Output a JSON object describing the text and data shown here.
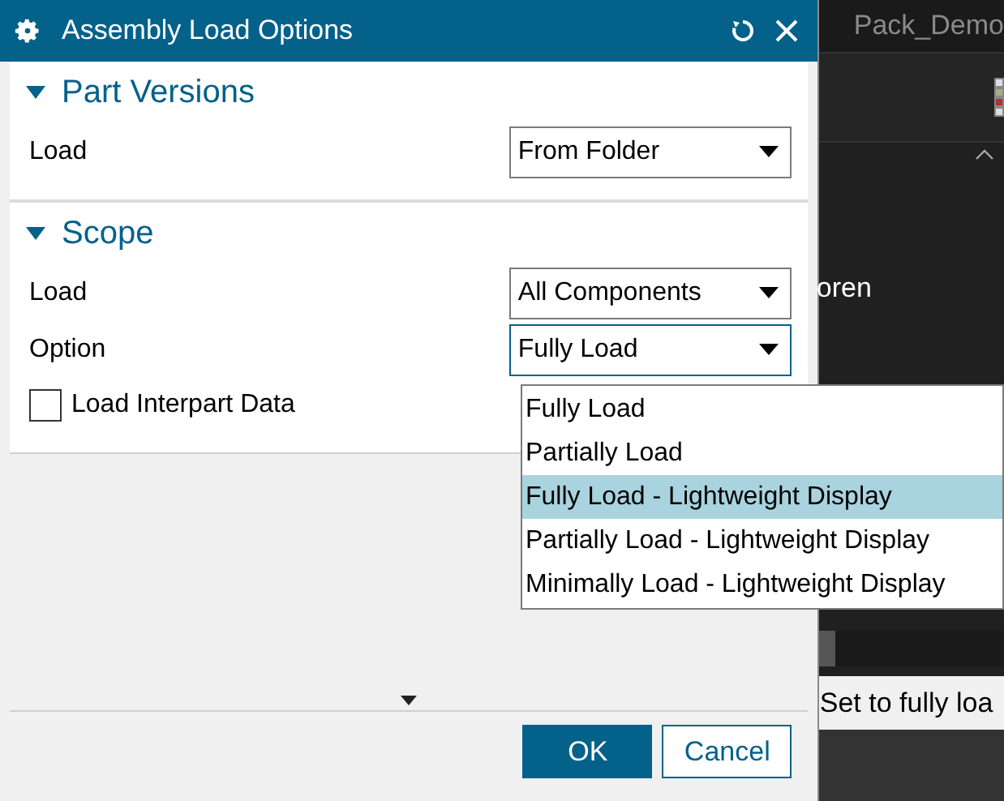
{
  "window": {
    "title": "Assembly Load Options"
  },
  "sections": [
    {
      "title": "Part Versions",
      "expanded": true,
      "rows": [
        {
          "kind": "dropdown",
          "label": "Load",
          "value": "From Folder",
          "open": false
        }
      ]
    },
    {
      "title": "Scope",
      "expanded": true,
      "rows": [
        {
          "kind": "dropdown",
          "label": "Load",
          "value": "All Components",
          "open": false
        },
        {
          "kind": "dropdown",
          "label": "Option",
          "value": "Fully Load",
          "open": true
        },
        {
          "kind": "checkbox",
          "label": "Load Interpart Data",
          "checked": false
        }
      ]
    }
  ],
  "dropdown_list": [
    {
      "label": "Fully Load",
      "selected": false
    },
    {
      "label": "Partially Load",
      "selected": false
    },
    {
      "label": "Fully Load - Lightweight Display",
      "selected": true
    },
    {
      "label": "Partially Load - Lightweight Display",
      "selected": false
    },
    {
      "label": "Minimally Load - Lightweight Display",
      "selected": false
    }
  ],
  "buttons": [
    {
      "label": "OK",
      "kind": "primary"
    },
    {
      "label": "Cancel",
      "kind": "secondary"
    }
  ],
  "background": {
    "tab": "Pack_Demo",
    "text": "oren",
    "hint": "Set to fully loa"
  }
}
